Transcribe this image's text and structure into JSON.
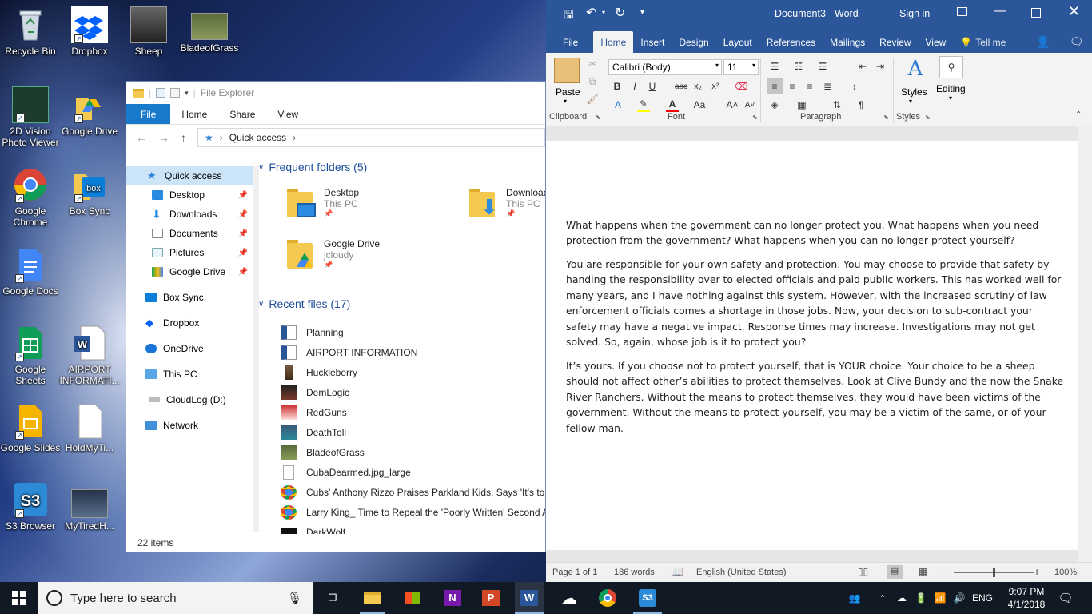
{
  "desktop": {
    "icons": [
      {
        "label": "Recycle Bin",
        "icon": "recycle-bin-icon"
      },
      {
        "label": "Dropbox",
        "icon": "dropbox-icon"
      },
      {
        "label": "Sheep",
        "icon": "image-thumbnail-icon"
      },
      {
        "label": "BladeofGrass",
        "icon": "image-thumbnail-icon"
      },
      {
        "label": "2D Vision Photo Viewer",
        "icon": "photo-viewer-icon"
      },
      {
        "label": "Google Drive",
        "icon": "google-drive-icon"
      },
      {
        "label": "Google Chrome",
        "icon": "chrome-icon"
      },
      {
        "label": "Box Sync",
        "icon": "box-icon"
      },
      {
        "label": "Google Docs",
        "icon": "google-docs-icon"
      },
      {
        "label": "Google Sheets",
        "icon": "google-sheets-icon"
      },
      {
        "label": "AIRPORT INFORMATI...",
        "icon": "word-document-icon"
      },
      {
        "label": "Google Slides",
        "icon": "google-slides-icon"
      },
      {
        "label": "HoldMyTi...",
        "icon": "blank-file-icon"
      },
      {
        "label": "S3 Browser",
        "icon": "s3-icon"
      },
      {
        "label": "MyTiredH...",
        "icon": "image-thumbnail-icon"
      }
    ]
  },
  "explorer": {
    "title": "File Explorer",
    "tabs": [
      "File",
      "Home",
      "Share",
      "View"
    ],
    "breadcrumb": "Quick access",
    "nav": [
      {
        "label": "Quick access",
        "pinned": false
      },
      {
        "label": "Desktop",
        "pinned": true
      },
      {
        "label": "Downloads",
        "pinned": true
      },
      {
        "label": "Documents",
        "pinned": true
      },
      {
        "label": "Pictures",
        "pinned": true
      },
      {
        "label": "Google Drive",
        "pinned": true
      },
      {
        "label": "Box Sync",
        "pinned": false
      },
      {
        "label": "Dropbox",
        "pinned": false
      },
      {
        "label": "OneDrive",
        "pinned": false
      },
      {
        "label": "This PC",
        "pinned": false
      },
      {
        "label": "CloudLog (D:)",
        "pinned": false
      },
      {
        "label": "Network",
        "pinned": false
      }
    ],
    "frequent_header": "Frequent folders (5)",
    "frequent": [
      {
        "name": "Desktop",
        "sub": "This PC"
      },
      {
        "name": "Download",
        "sub": "This PC"
      },
      {
        "name": "Google Drive",
        "sub": "jcloudy"
      }
    ],
    "recent_header": "Recent files (17)",
    "recent": [
      "Planning",
      "AIRPORT INFORMATION",
      "Huckleberry",
      "DemLogic",
      "RedGuns",
      "DeathToll",
      "BladeofGrass",
      "CubaDearmed.jpg_large",
      "Cubs' Anthony Rizzo Praises Parkland Kids, Says 'It's too E",
      "Larry King_ Time to Repeal the 'Poorly Written' Second A",
      "DarkWolf"
    ],
    "status": "22 items"
  },
  "word": {
    "title": "Document3  -  Word",
    "signin": "Sign in",
    "tabs": [
      "File",
      "Home",
      "Insert",
      "Design",
      "Layout",
      "References",
      "Mailings",
      "Review",
      "View"
    ],
    "tellme": "Tell me",
    "paste": "Paste",
    "font_name": "Calibri (Body)",
    "font_size": "11",
    "styles_label": "Styles",
    "editing_label": "Editing",
    "group_labels": {
      "clipboard": "Clipboard",
      "font": "Font",
      "paragraph": "Paragraph",
      "styles": "Styles"
    },
    "paragraphs": [
      "What happens when the government can no longer protect you. What happens when you need protection from the government? What happens when you can no longer protect yourself?",
      "You are responsible for your own safety and protection. You may choose to provide that safety by handing the responsibility over to elected officials and paid public workers. This has worked well for many years, and I have nothing against this system. However, with the increased scrutiny of law enforcement officials comes a shortage in those jobs. Now, your decision to sub-contract your safety may have a negative impact. Response times may increase. Investigations may not get solved. So, again, whose job is it to protect you?",
      "It’s yours. If you choose not to protect yourself, that is YOUR choice. Your choice to be a sheep should not affect other’s abilities to protect themselves. Look at Clive Bundy and the now the Snake River Ranchers. Without the means to protect themselves, they would have been victims of the government. Without the means to protect yourself, you may be a victim of the same, or of your fellow man."
    ],
    "status": {
      "page": "Page 1 of 1",
      "words": "186 words",
      "language": "English (United States)",
      "zoom": "100%",
      "zoom_level": 1.0
    }
  },
  "taskbar": {
    "search_placeholder": "Type here to search",
    "language": "ENG",
    "time": "9:07 PM",
    "date": "4/1/2018"
  }
}
